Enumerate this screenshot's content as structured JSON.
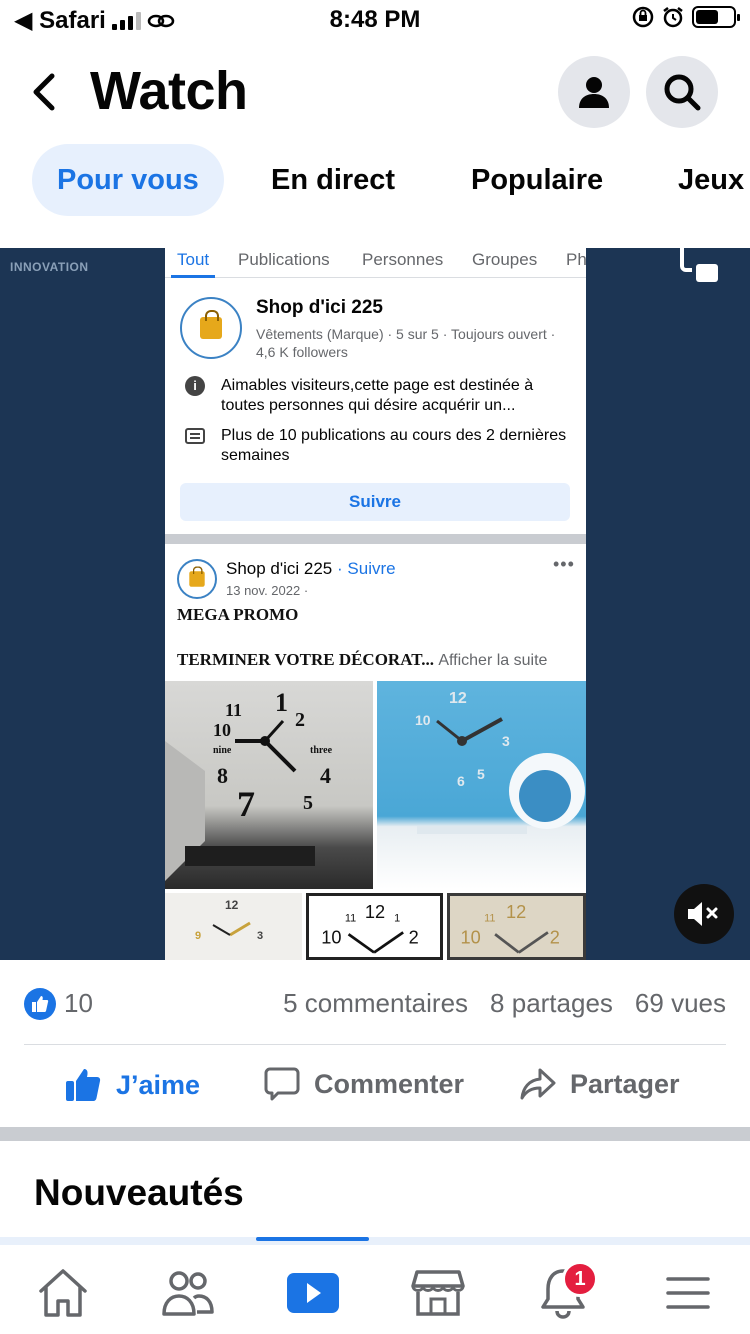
{
  "status_bar": {
    "carrier": "◀ Safari",
    "time": "8:48 PM"
  },
  "header": {
    "title": "Watch"
  },
  "tabs": [
    {
      "label": "Pour vous",
      "active": true
    },
    {
      "label": "En direct",
      "active": false
    },
    {
      "label": "Populaire",
      "active": false
    },
    {
      "label": "Jeux",
      "active": false
    }
  ],
  "video": {
    "watermark": "INNOVATION",
    "fb_tabs": [
      "Tout",
      "Publications",
      "Personnes",
      "Groupes",
      "Ph"
    ],
    "page": {
      "name": "Shop d'ici 225",
      "meta": "Vêtements (Marque) · 5 sur 5 · Toujours ouvert · 4,6 K followers",
      "info1": "Aimables visiteurs,cette page est destinée à toutes personnes qui désire acquérir un...",
      "info2": "Plus de 10 publications au cours des 2 dernières semaines",
      "follow_button": "Suivre"
    },
    "post": {
      "author": "Shop d'ici 225",
      "follow": "· Suivre",
      "date": "13 nov. 2022 ·",
      "line1": "MEGA PROMO",
      "line2": "TERMINER VOTRE DÉCORAT...",
      "see_more": "Afficher la suite",
      "dots": "•••"
    }
  },
  "stats": {
    "likes": "10",
    "comments": "5 commentaires",
    "shares": "8 partages",
    "views": "69 vues"
  },
  "actions": {
    "like": "J’aime",
    "comment": "Commenter",
    "share": "Partager"
  },
  "section": {
    "title": "Nouveautés"
  },
  "bottom_nav": {
    "notification_count": "1",
    "items": [
      "home-icon",
      "friends-icon",
      "watch-icon",
      "marketplace-icon",
      "bell-icon",
      "menu-icon"
    ]
  },
  "colors": {
    "accent": "#1b74e4",
    "video_bg": "#1c3554",
    "badge": "#e41e3f"
  }
}
